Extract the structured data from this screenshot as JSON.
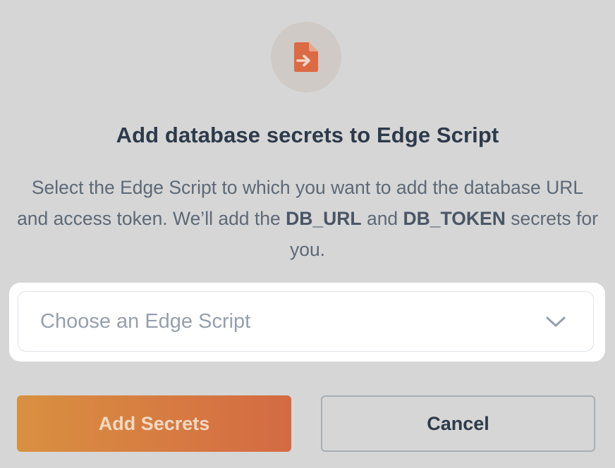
{
  "dialog": {
    "icon": "file-import-icon",
    "title": "Add database secrets to Edge Script",
    "description": {
      "part1": "Select the Edge Script to which you want to add the database URL and access token. We’ll add the ",
      "db_url": "DB_URL",
      "and": " and ",
      "db_token": "DB_TOKEN",
      "part2": " secrets for you."
    },
    "select": {
      "placeholder": "Choose an Edge Script",
      "icon": "chevron-down-icon"
    },
    "buttons": {
      "add_secrets": "Add Secrets",
      "cancel": "Cancel"
    }
  },
  "colors": {
    "accent": "#D86D43",
    "overlay_background": "#D6D6D6",
    "title_text": "#2D3A4A",
    "body_text": "#5D6977"
  }
}
